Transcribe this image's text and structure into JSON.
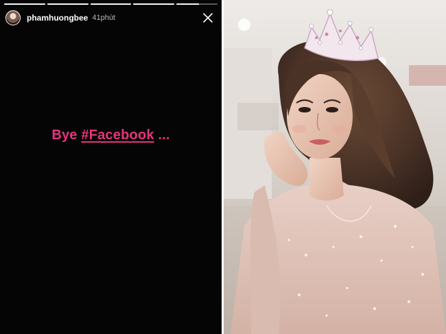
{
  "story": {
    "username": "phamhuongbee",
    "time": "41phút",
    "caption_prefix": "Bye ",
    "caption_tag": "#Facebook",
    "caption_suffix": " ...",
    "caption_color": "#e8337e",
    "progress": [
      1,
      1,
      1,
      1,
      0.55
    ],
    "close_icon": "close-icon"
  },
  "photo": {
    "subject": "woman-with-crown"
  }
}
